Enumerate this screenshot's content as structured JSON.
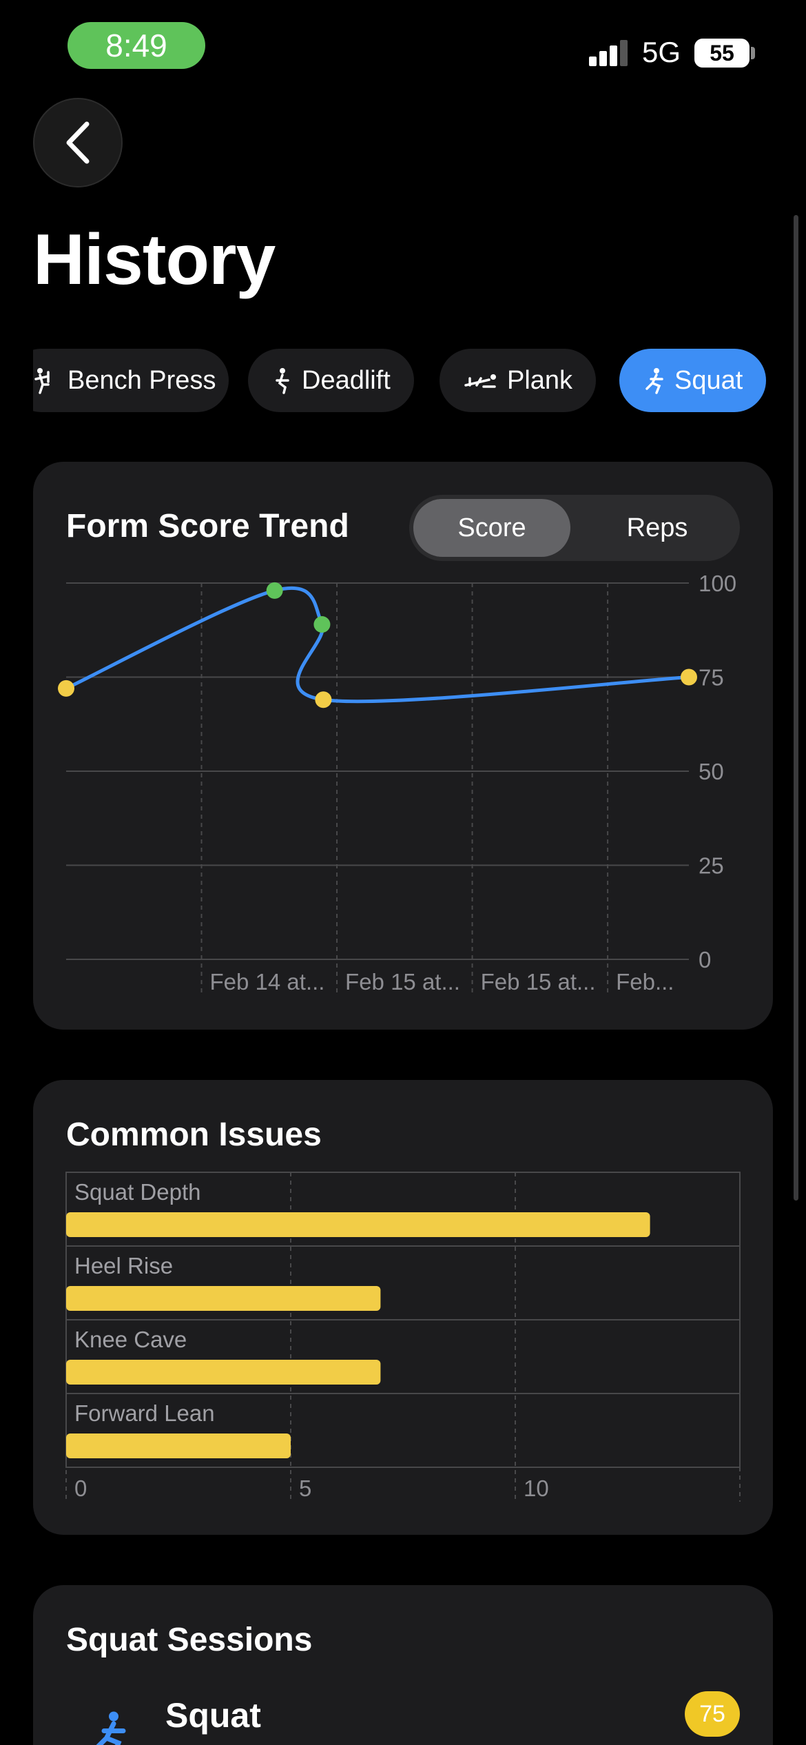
{
  "status_bar": {
    "time": "8:49",
    "network": "5G",
    "battery": "55"
  },
  "page": {
    "title": "History"
  },
  "exercise_tabs": [
    {
      "label": "Bench Press",
      "icon": "bench-press-icon",
      "active": false
    },
    {
      "label": "Deadlift",
      "icon": "deadlift-icon",
      "active": false
    },
    {
      "label": "Plank",
      "icon": "plank-icon",
      "active": false
    },
    {
      "label": "Squat",
      "icon": "squat-icon",
      "active": true
    }
  ],
  "trend_card": {
    "title": "Form Score Trend",
    "toggle": {
      "options": [
        "Score",
        "Reps"
      ],
      "selected": "Score"
    }
  },
  "issues_card": {
    "title": "Common Issues"
  },
  "sessions_card": {
    "title": "Squat Sessions",
    "sessions": [
      {
        "name": "Squat",
        "score": "75",
        "icon": "squat-icon"
      }
    ]
  },
  "colors": {
    "accent": "#3d8ef5",
    "good": "#5fc35a",
    "warn": "#f2cd47",
    "card": "#1c1c1e"
  },
  "chart_data": [
    {
      "type": "line",
      "title": "Form Score Trend",
      "x_tick_labels": [
        "Feb 14 at...",
        "Feb 15 at...",
        "Feb 15 at...",
        "Feb..."
      ],
      "ylim": [
        0,
        100
      ],
      "y_ticks": [
        0,
        25,
        50,
        75,
        100
      ],
      "grid": true,
      "series": [
        {
          "points": [
            {
              "x": 0.0,
              "y": 72,
              "status": "warn"
            },
            {
              "x": 1.54,
              "y": 98,
              "status": "good"
            },
            {
              "x": 1.89,
              "y": 89,
              "status": "good"
            },
            {
              "x": 1.9,
              "y": 69,
              "status": "warn"
            },
            {
              "x": 4.6,
              "y": 75,
              "status": "warn"
            }
          ]
        }
      ]
    },
    {
      "type": "bar",
      "title": "Common Issues",
      "orientation": "horizontal",
      "categories": [
        "Squat Depth",
        "Heel Rise",
        "Knee Cave",
        "Forward Lean"
      ],
      "values": [
        13,
        7,
        7,
        5
      ],
      "xlim": [
        0,
        15
      ],
      "x_ticks": [
        0,
        5,
        10
      ],
      "grid": true
    }
  ]
}
